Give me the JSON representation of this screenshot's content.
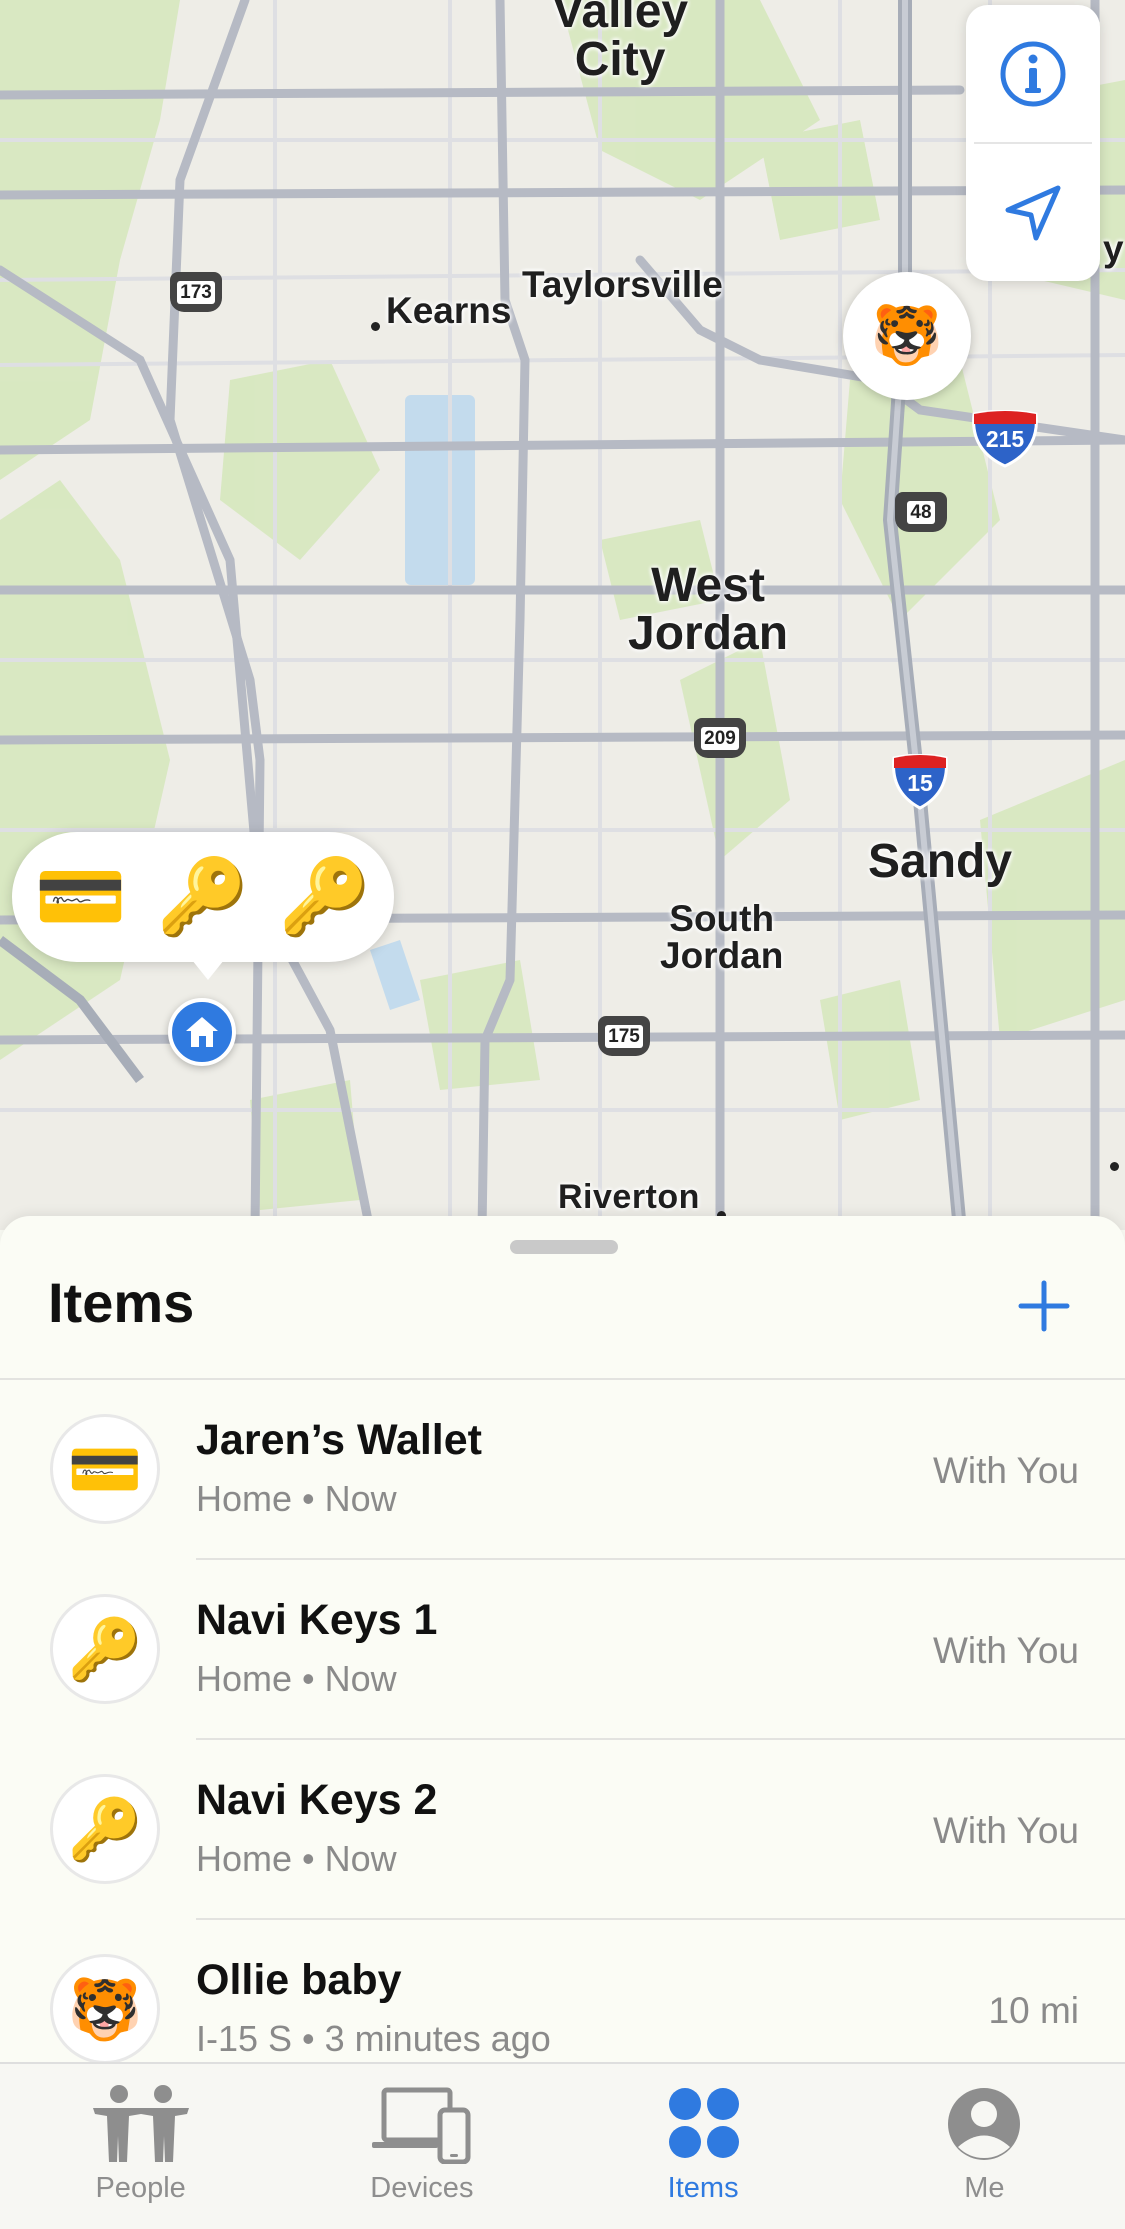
{
  "map": {
    "cities": {
      "valley_city_1": "Valley",
      "valley_city_2": "City",
      "taylorsville": "Taylorsville",
      "kearns": "Kearns",
      "west_jordan_1": "West",
      "west_jordan_2": "Jordan",
      "sandy": "Sandy",
      "south_jordan_1": "South",
      "south_jordan_2": "Jordan",
      "riverton": "Riverton",
      "partial_right": "y"
    },
    "shields": {
      "sr173": "173",
      "sr48": "48",
      "sr209": "209",
      "sr175": "175",
      "i215": "215",
      "i15": "15"
    },
    "controls": {
      "info_icon": "info-icon",
      "location_icon": "location-arrow-icon"
    },
    "pins": {
      "tiger": "🐯",
      "cluster": [
        "💳",
        "🔑",
        "🔑"
      ],
      "home_icon": "house-icon"
    }
  },
  "sheet": {
    "title": "Items",
    "add_icon": "plus-icon",
    "items": [
      {
        "icon": "💳",
        "name": "Jaren’s Wallet",
        "location": "Home",
        "time": "Now",
        "status": "With You"
      },
      {
        "icon": "🔑",
        "name": "Navi Keys 1",
        "location": "Home",
        "time": "Now",
        "status": "With You"
      },
      {
        "icon": "🔑",
        "name": "Navi Keys 2",
        "location": "Home",
        "time": "Now",
        "status": "With You"
      },
      {
        "icon": "🐯",
        "name": "Ollie baby",
        "location": "I-15 S",
        "time": "3 minutes ago",
        "status": "10 mi"
      }
    ]
  },
  "tabs": [
    {
      "label": "People",
      "icon": "people-icon",
      "active": false
    },
    {
      "label": "Devices",
      "icon": "devices-icon",
      "active": false
    },
    {
      "label": "Items",
      "icon": "items-icon",
      "active": true
    },
    {
      "label": "Me",
      "icon": "person-circle-icon",
      "active": false
    }
  ],
  "colors": {
    "accent": "#2f7ae0",
    "map_background": "#eeede7",
    "park_green": "#d6e8bf",
    "road": "#b8bcc6"
  }
}
